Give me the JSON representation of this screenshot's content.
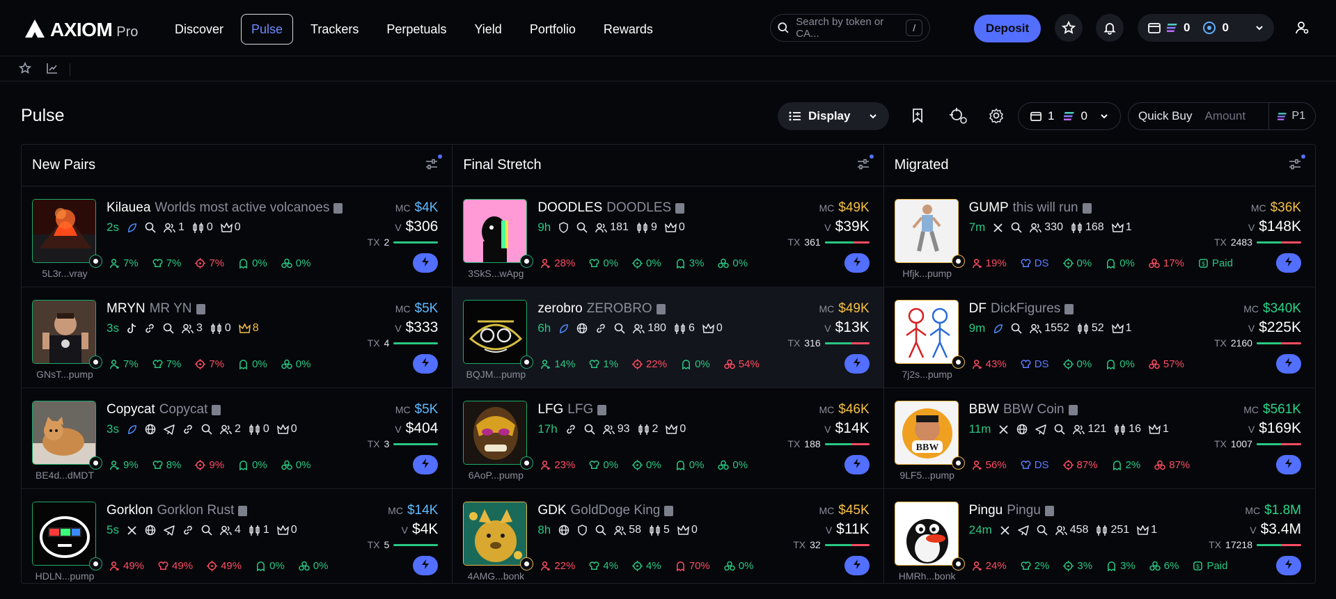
{
  "brand": {
    "name": "AXIOM",
    "tier": "Pro"
  },
  "nav": [
    {
      "label": "Discover",
      "active": false
    },
    {
      "label": "Pulse",
      "active": true
    },
    {
      "label": "Trackers",
      "active": false
    },
    {
      "label": "Perpetuals",
      "active": false
    },
    {
      "label": "Yield",
      "active": false
    },
    {
      "label": "Portfolio",
      "active": false
    },
    {
      "label": "Rewards",
      "active": false
    }
  ],
  "search": {
    "placeholder": "Search by token or CA...",
    "shortcut": "/"
  },
  "deposit_label": "Deposit",
  "wallet": {
    "sol_balance": "0",
    "points_balance": "0"
  },
  "page_title": "Pulse",
  "toolbar": {
    "display_label": "Display",
    "preset_wallets": "1",
    "preset_sol": "0",
    "quick_buy_label": "Quick Buy",
    "amount_placeholder": "Amount",
    "preset_label": "P1"
  },
  "colors": {
    "accent": "#526fff",
    "green": "#29c783",
    "red": "#ff4d62",
    "gold": "#f5c044"
  },
  "columns": [
    {
      "title": "New Pairs",
      "cards": [
        {
          "symbol": "Kilauea",
          "name": "Worlds most active volcanoes",
          "age": "2s",
          "addr": "5L3r...vray",
          "holders": "1",
          "pro": "0",
          "kol": "0",
          "mc": "$4K",
          "vol": "$306",
          "tx": "2",
          "buy_ratio": 1.0,
          "border": "green",
          "stats": [
            {
              "v": "7%",
              "c": "g",
              "i": "user"
            },
            {
              "v": "7%",
              "c": "g",
              "i": "chef"
            },
            {
              "v": "7%",
              "c": "r",
              "i": "target"
            },
            {
              "v": "0%",
              "c": "g",
              "i": "ghost"
            },
            {
              "v": "0%",
              "c": "g",
              "i": "bundle"
            }
          ]
        },
        {
          "symbol": "MRYN",
          "name": "MR YN",
          "age": "3s",
          "addr": "GNsT...pump",
          "holders": "3",
          "pro": "0",
          "kol": "8",
          "mc": "$5K",
          "vol": "$333",
          "tx": "4",
          "buy_ratio": 1.0,
          "border": "green",
          "stats": [
            {
              "v": "7%",
              "c": "g",
              "i": "user"
            },
            {
              "v": "7%",
              "c": "g",
              "i": "chef"
            },
            {
              "v": "7%",
              "c": "r",
              "i": "target"
            },
            {
              "v": "0%",
              "c": "g",
              "i": "ghost"
            },
            {
              "v": "0%",
              "c": "g",
              "i": "bundle"
            }
          ]
        },
        {
          "symbol": "Copycat",
          "name": "Copycat",
          "age": "3s",
          "addr": "BE4d...dMDT",
          "holders": "2",
          "pro": "0",
          "kol": "0",
          "mc": "$5K",
          "vol": "$404",
          "tx": "3",
          "buy_ratio": 1.0,
          "border": "green",
          "stats": [
            {
              "v": "9%",
              "c": "g",
              "i": "user"
            },
            {
              "v": "8%",
              "c": "g",
              "i": "chef"
            },
            {
              "v": "9%",
              "c": "r",
              "i": "target"
            },
            {
              "v": "0%",
              "c": "g",
              "i": "ghost"
            },
            {
              "v": "0%",
              "c": "g",
              "i": "bundle"
            }
          ]
        },
        {
          "symbol": "Gorklon",
          "name": "Gorklon Rust",
          "age": "5s",
          "addr": "HDLN...pump",
          "holders": "4",
          "pro": "1",
          "kol": "0",
          "mc": "$14K",
          "vol": "$4K",
          "tx": "5",
          "buy_ratio": 1.0,
          "border": "green",
          "stats": [
            {
              "v": "49%",
              "c": "r",
              "i": "user"
            },
            {
              "v": "49%",
              "c": "r",
              "i": "chef"
            },
            {
              "v": "49%",
              "c": "r",
              "i": "target"
            },
            {
              "v": "0%",
              "c": "g",
              "i": "ghost"
            },
            {
              "v": "0%",
              "c": "g",
              "i": "bundle"
            }
          ]
        }
      ]
    },
    {
      "title": "Final Stretch",
      "cards": [
        {
          "symbol": "DOODLES",
          "name": "DOODLES",
          "age": "9h",
          "addr": "3SkS...wApg",
          "holders": "181",
          "pro": "9",
          "kol": "0",
          "mc": "$49K",
          "vol": "$39K",
          "tx": "361",
          "buy_ratio": 0.65,
          "border": "green",
          "stats": [
            {
              "v": "28%",
              "c": "r",
              "i": "user"
            },
            {
              "v": "0%",
              "c": "g",
              "i": "chef"
            },
            {
              "v": "0%",
              "c": "g",
              "i": "target"
            },
            {
              "v": "3%",
              "c": "g",
              "i": "ghost"
            },
            {
              "v": "0%",
              "c": "g",
              "i": "bundle"
            }
          ]
        },
        {
          "symbol": "zerobro",
          "name": "ZEROBRO",
          "age": "6h",
          "addr": "BQJM...pump",
          "holders": "180",
          "pro": "6",
          "kol": "0",
          "mc": "$49K",
          "vol": "$13K",
          "tx": "316",
          "buy_ratio": 0.6,
          "border": "green",
          "stats": [
            {
              "v": "14%",
              "c": "g",
              "i": "user"
            },
            {
              "v": "1%",
              "c": "g",
              "i": "chef"
            },
            {
              "v": "22%",
              "c": "r",
              "i": "target"
            },
            {
              "v": "0%",
              "c": "g",
              "i": "ghost"
            },
            {
              "v": "54%",
              "c": "r",
              "i": "bundle"
            }
          ]
        },
        {
          "symbol": "LFG",
          "name": "LFG",
          "age": "17h",
          "addr": "6AoP...pump",
          "holders": "93",
          "pro": "2",
          "kol": "0",
          "mc": "$46K",
          "vol": "$14K",
          "tx": "188",
          "buy_ratio": 0.6,
          "border": "green",
          "stats": [
            {
              "v": "23%",
              "c": "r",
              "i": "user"
            },
            {
              "v": "0%",
              "c": "g",
              "i": "chef"
            },
            {
              "v": "0%",
              "c": "g",
              "i": "target"
            },
            {
              "v": "0%",
              "c": "g",
              "i": "ghost"
            },
            {
              "v": "0%",
              "c": "g",
              "i": "bundle"
            }
          ]
        },
        {
          "symbol": "GDK",
          "name": "GoldDoge King",
          "age": "8h",
          "addr": "4AMG...bonk",
          "holders": "58",
          "pro": "5",
          "kol": "0",
          "mc": "$45K",
          "vol": "$11K",
          "tx": "32",
          "buy_ratio": 0.6,
          "border": "gold",
          "stats": [
            {
              "v": "22%",
              "c": "r",
              "i": "user"
            },
            {
              "v": "4%",
              "c": "g",
              "i": "chef"
            },
            {
              "v": "4%",
              "c": "g",
              "i": "target"
            },
            {
              "v": "70%",
              "c": "r",
              "i": "ghost"
            },
            {
              "v": "0%",
              "c": "g",
              "i": "bundle"
            }
          ]
        }
      ]
    },
    {
      "title": "Migrated",
      "cards": [
        {
          "symbol": "GUMP",
          "name": "this will run",
          "age": "7m",
          "addr": "Hfjk...pump",
          "holders": "330",
          "pro": "168",
          "kol": "1",
          "mc": "$36K",
          "vol": "$148K",
          "tx": "2483",
          "buy_ratio": 0.55,
          "border": "gold",
          "stats": [
            {
              "v": "19%",
              "c": "r",
              "i": "user"
            },
            {
              "v": "DS",
              "c": "b",
              "i": "chef"
            },
            {
              "v": "0%",
              "c": "g",
              "i": "target"
            },
            {
              "v": "0%",
              "c": "g",
              "i": "ghost"
            },
            {
              "v": "17%",
              "c": "r",
              "i": "bundle"
            },
            {
              "v": "Paid",
              "c": "g",
              "i": "paid"
            }
          ]
        },
        {
          "symbol": "DF",
          "name": "DickFigures",
          "age": "9m",
          "addr": "7j2s...pump",
          "holders": "1552",
          "pro": "52",
          "kol": "1",
          "mc": "$340K",
          "vol": "$225K",
          "tx": "2160",
          "buy_ratio": 0.55,
          "border": "gold",
          "stats": [
            {
              "v": "43%",
              "c": "r",
              "i": "user"
            },
            {
              "v": "DS",
              "c": "b",
              "i": "chef"
            },
            {
              "v": "0%",
              "c": "g",
              "i": "target"
            },
            {
              "v": "0%",
              "c": "g",
              "i": "ghost"
            },
            {
              "v": "57%",
              "c": "r",
              "i": "bundle"
            }
          ]
        },
        {
          "symbol": "BBW",
          "name": "BBW Coin",
          "age": "11m",
          "addr": "9LF5...pump",
          "holders": "121",
          "pro": "16",
          "kol": "1",
          "mc": "$561K",
          "vol": "$169K",
          "tx": "1007",
          "buy_ratio": 0.55,
          "border": "gold",
          "stats": [
            {
              "v": "56%",
              "c": "r",
              "i": "user"
            },
            {
              "v": "DS",
              "c": "b",
              "i": "chef"
            },
            {
              "v": "87%",
              "c": "r",
              "i": "target"
            },
            {
              "v": "2%",
              "c": "g",
              "i": "ghost"
            },
            {
              "v": "87%",
              "c": "r",
              "i": "bundle"
            }
          ]
        },
        {
          "symbol": "Pingu",
          "name": "Pingu",
          "age": "24m",
          "addr": "HMRh...bonk",
          "holders": "458",
          "pro": "251",
          "kol": "1",
          "mc": "$1.8M",
          "vol": "$3.4M",
          "tx": "17218",
          "buy_ratio": 0.55,
          "border": "gold",
          "stats": [
            {
              "v": "24%",
              "c": "r",
              "i": "user"
            },
            {
              "v": "2%",
              "c": "g",
              "i": "chef"
            },
            {
              "v": "3%",
              "c": "g",
              "i": "target"
            },
            {
              "v": "3%",
              "c": "g",
              "i": "ghost"
            },
            {
              "v": "6%",
              "c": "g",
              "i": "bundle"
            },
            {
              "v": "Paid",
              "c": "g",
              "i": "paid"
            }
          ]
        }
      ]
    }
  ]
}
